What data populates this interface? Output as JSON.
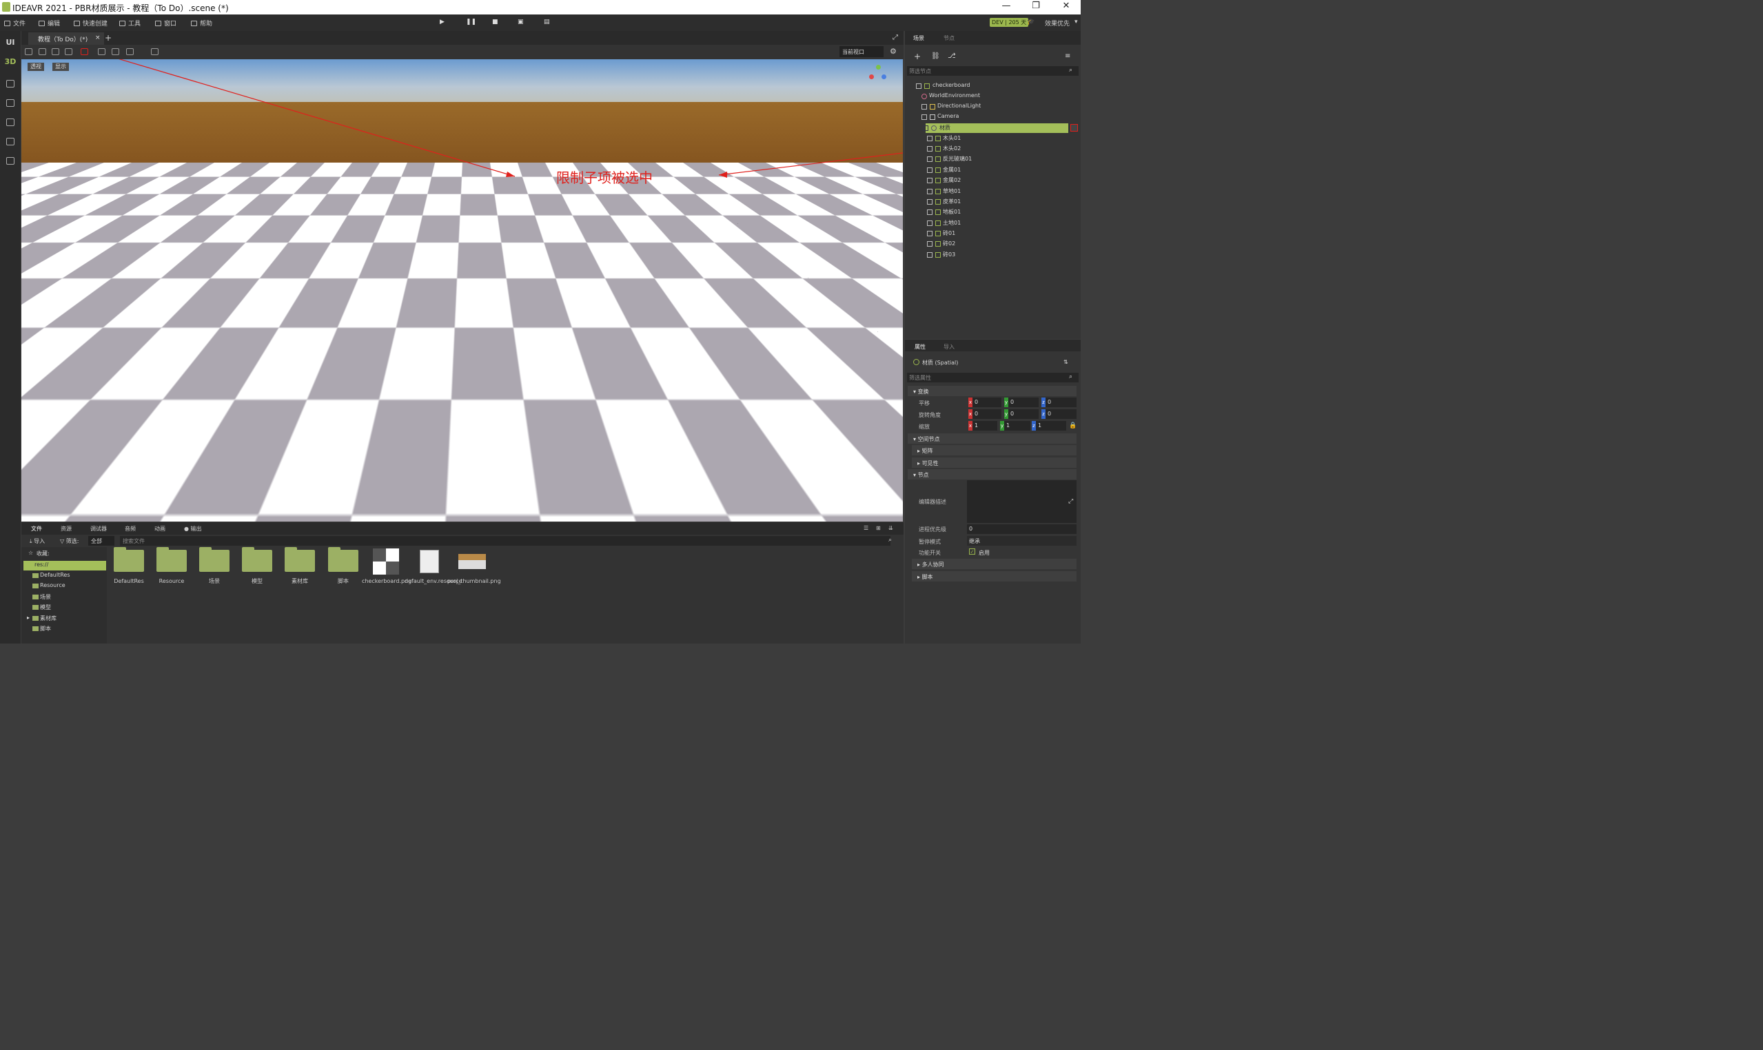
{
  "window": {
    "title": "IDEAVR 2021 - PBR材质展示 - 教程（To Do）.scene (*)"
  },
  "menu": [
    {
      "label": "文件"
    },
    {
      "label": "编辑"
    },
    {
      "label": "快速创建"
    },
    {
      "label": "工具"
    },
    {
      "label": "窗口"
    },
    {
      "label": "帮助"
    }
  ],
  "topright": {
    "dev_badge": "DEV | 205 天",
    "quality": "效果优先"
  },
  "leftbar": {
    "ui": "UI",
    "mode3d": "3D"
  },
  "editor_tab": {
    "label": "教程（To Do）(*)"
  },
  "viewport": {
    "view_select": "当前视口",
    "perspective": "透视",
    "display": "显示",
    "annotation": "限制子项被选中"
  },
  "right_tabs": {
    "scene": "场景",
    "node": "节点"
  },
  "scene_tree": {
    "filter_placeholder": "筛选节点",
    "nodes": [
      {
        "label": "checkerboard"
      },
      {
        "label": "WorldEnvironment"
      },
      {
        "label": "DirectionalLight"
      },
      {
        "label": "Camera"
      },
      {
        "label": "材质"
      },
      {
        "label": "木头01"
      },
      {
        "label": "木头02"
      },
      {
        "label": "反光玻璃01"
      },
      {
        "label": "金属01"
      },
      {
        "label": "金属02"
      },
      {
        "label": "草地01"
      },
      {
        "label": "皮革01"
      },
      {
        "label": "地板01"
      },
      {
        "label": "土地01"
      },
      {
        "label": "砖01"
      },
      {
        "label": "砖02"
      },
      {
        "label": "砖03"
      }
    ]
  },
  "inspector_tabs": {
    "props": "属性",
    "import": "导入"
  },
  "inspector": {
    "node_title": "材质 (Spatial)",
    "filter_placeholder": "筛选属性",
    "sec_transform": "变换",
    "translate": "平移",
    "rotate": "旋转角度",
    "scale": "缩放",
    "ax": "x",
    "ay": "y",
    "az": "z",
    "translate_vals": [
      "0",
      "0",
      "0"
    ],
    "rotate_vals": [
      "0",
      "0",
      "0"
    ],
    "scale_vals": [
      "1",
      "1",
      "1"
    ],
    "sec_spatial": "空间节点",
    "matrix": "矩阵",
    "visibility": "可见性",
    "sec_node": "节点",
    "editor_desc": "编辑器描述",
    "process_priority": "进程优先级",
    "process_priority_val": "0",
    "pause_mode": "暂停模式",
    "pause_mode_val": "继承",
    "feature_switch": "功能开关",
    "feature_switch_val": "启用",
    "multiplayer": "多人协同",
    "script": "脚本"
  },
  "bottom": {
    "tabs": [
      {
        "label": "文件"
      },
      {
        "label": "资源"
      },
      {
        "label": "调试器"
      },
      {
        "label": "音频"
      },
      {
        "label": "动画"
      },
      {
        "label": "输出"
      }
    ],
    "import": "导入",
    "filter": "筛选:",
    "filter_val": "全部",
    "search_placeholder": "搜索文件",
    "favorites": "收藏:",
    "fs_tree": [
      {
        "label": "res://"
      },
      {
        "label": "DefaultRes"
      },
      {
        "label": "Resource"
      },
      {
        "label": "场景"
      },
      {
        "label": "模型"
      },
      {
        "label": "素材库"
      },
      {
        "label": "脚本"
      }
    ],
    "files": [
      {
        "label": "DefaultRes"
      },
      {
        "label": "Resource"
      },
      {
        "label": "场景"
      },
      {
        "label": "模型"
      },
      {
        "label": "素材库"
      },
      {
        "label": "脚本"
      },
      {
        "label": "checkerboard.png"
      },
      {
        "label": "default_env.resource"
      },
      {
        "label": "proj_thumbnail.png"
      }
    ]
  },
  "colors": {
    "accent": "#a4bf5a",
    "annotation": "#e0201c"
  }
}
